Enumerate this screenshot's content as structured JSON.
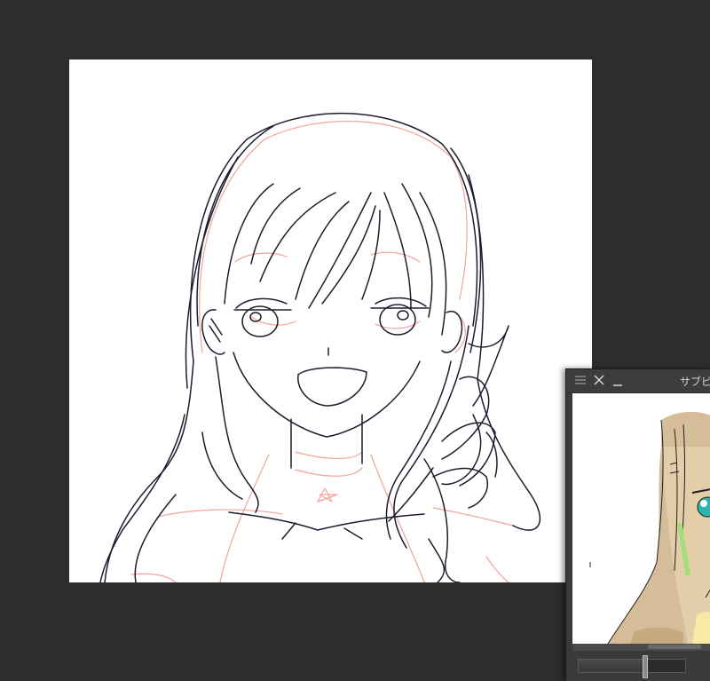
{
  "subview": {
    "title": "サブビ",
    "zoom_level": 0.62
  },
  "colors": {
    "workspace_bg": "#2d2d2d",
    "lineart": "#1c1c2e",
    "rough": "#f2a49b",
    "hair_flat": "#d6bd99",
    "eye": "#2fb5b0",
    "highlight": "#9fe07a"
  },
  "icons": [
    "menu-icon",
    "close-icon",
    "minimize-icon"
  ]
}
